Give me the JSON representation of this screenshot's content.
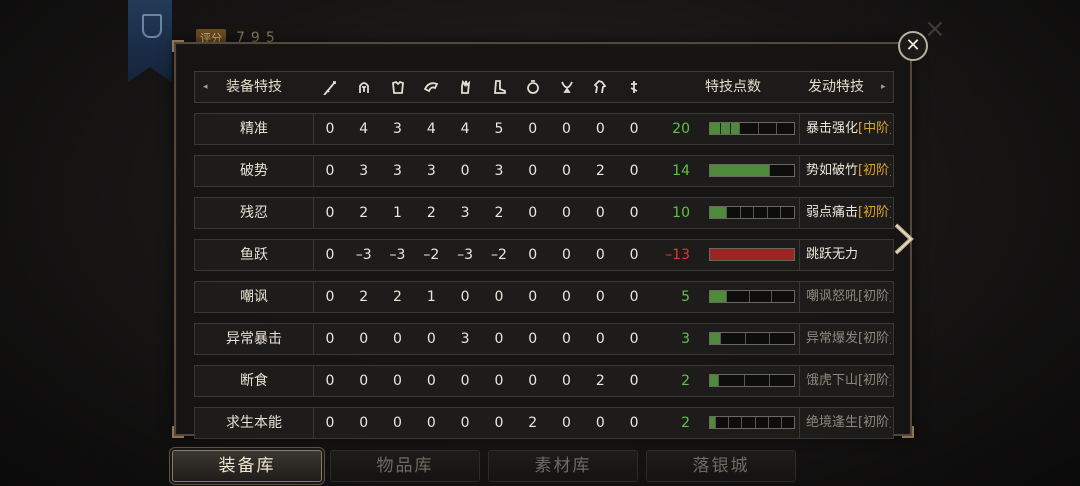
{
  "header": {
    "score_label": "评分",
    "score_value": "795"
  },
  "table": {
    "col_name": "装备特技",
    "col_points": "特技点数",
    "col_skill": "发动特技",
    "equip_icons": [
      "sword-icon",
      "helmet-icon",
      "armor-icon",
      "shoulder-icon",
      "glove-icon",
      "boots-icon",
      "ring-icon",
      "necklace-icon",
      "horse-icon",
      "charm-icon"
    ],
    "rows": [
      {
        "name": "精准",
        "values": [
          "0",
          "4",
          "3",
          "4",
          "4",
          "5",
          "0",
          "0",
          "0",
          "0"
        ],
        "points": "20",
        "level": 0.35,
        "segments": [
          3,
          3
        ],
        "bar_color": "#4e8a3a",
        "pts_color": "#5fc24a",
        "skill": "暴击强化",
        "tier": "[中阶]",
        "active": true
      },
      {
        "name": "破势",
        "values": [
          "0",
          "3",
          "3",
          "3",
          "0",
          "3",
          "0",
          "0",
          "2",
          "0"
        ],
        "points": "14",
        "level": 0.7,
        "segments": [
          1,
          1
        ],
        "bar_color": "#4e8a3a",
        "pts_color": "#5fc24a",
        "skill": "势如破竹",
        "tier": "[初阶]",
        "active": true
      },
      {
        "name": "残忍",
        "values": [
          "0",
          "2",
          "1",
          "2",
          "3",
          "2",
          "0",
          "0",
          "0",
          "0"
        ],
        "points": "10",
        "level": 0.19,
        "segments": [
          1,
          5
        ],
        "bar_color": "#4e8a3a",
        "pts_color": "#5fc24a",
        "skill": "弱点痛击",
        "tier": "[初阶]",
        "active": true
      },
      {
        "name": "鱼跃",
        "values": [
          "0",
          "–3",
          "–3",
          "–2",
          "–3",
          "–2",
          "0",
          "0",
          "0",
          "0"
        ],
        "points": "–13",
        "level": 1.0,
        "segments": [
          0,
          0
        ],
        "bar_color": "#9c2623",
        "pts_color": "#d83a30",
        "skill": "跳跃无力",
        "tier": "",
        "active": true
      },
      {
        "name": "嘲讽",
        "values": [
          "0",
          "2",
          "2",
          "1",
          "0",
          "0",
          "0",
          "0",
          "0",
          "0"
        ],
        "points": "5",
        "level": 0.19,
        "segments": [
          1,
          3
        ],
        "bar_color": "#4e8a3a",
        "pts_color": "#5fc24a",
        "skill": "嘲讽怒吼",
        "tier": "[初阶]",
        "active": false
      },
      {
        "name": "异常暴击",
        "values": [
          "0",
          "0",
          "0",
          "0",
          "3",
          "0",
          "0",
          "0",
          "0",
          "0"
        ],
        "points": "3",
        "level": 0.12,
        "segments": [
          1,
          3
        ],
        "bar_color": "#4e8a3a",
        "pts_color": "#5fc24a",
        "skill": "异常爆发",
        "tier": "[初阶]",
        "active": false
      },
      {
        "name": "断食",
        "values": [
          "0",
          "0",
          "0",
          "0",
          "0",
          "0",
          "0",
          "0",
          "2",
          "0"
        ],
        "points": "2",
        "level": 0.1,
        "segments": [
          1,
          3
        ],
        "bar_color": "#4e8a3a",
        "pts_color": "#5fc24a",
        "skill": "饿虎下山",
        "tier": "[初阶]",
        "active": false
      },
      {
        "name": "求生本能",
        "values": [
          "0",
          "0",
          "0",
          "0",
          "0",
          "0",
          "2",
          "0",
          "0",
          "0"
        ],
        "points": "2",
        "level": 0.06,
        "segments": [
          1,
          6
        ],
        "bar_color": "#4e8a3a",
        "pts_color": "#5fc24a",
        "skill": "绝境逢生",
        "tier": "[初阶]",
        "active": false
      }
    ]
  },
  "tabs": [
    {
      "label": "装备库",
      "active": true
    },
    {
      "label": "物品库",
      "active": false
    },
    {
      "label": "素材库",
      "active": false
    },
    {
      "label": "落银城",
      "active": false
    }
  ],
  "colors": {
    "tier_active": "#e0a12c",
    "skill_active": "#ece6d8",
    "skill_inactive": "#8d877c"
  }
}
